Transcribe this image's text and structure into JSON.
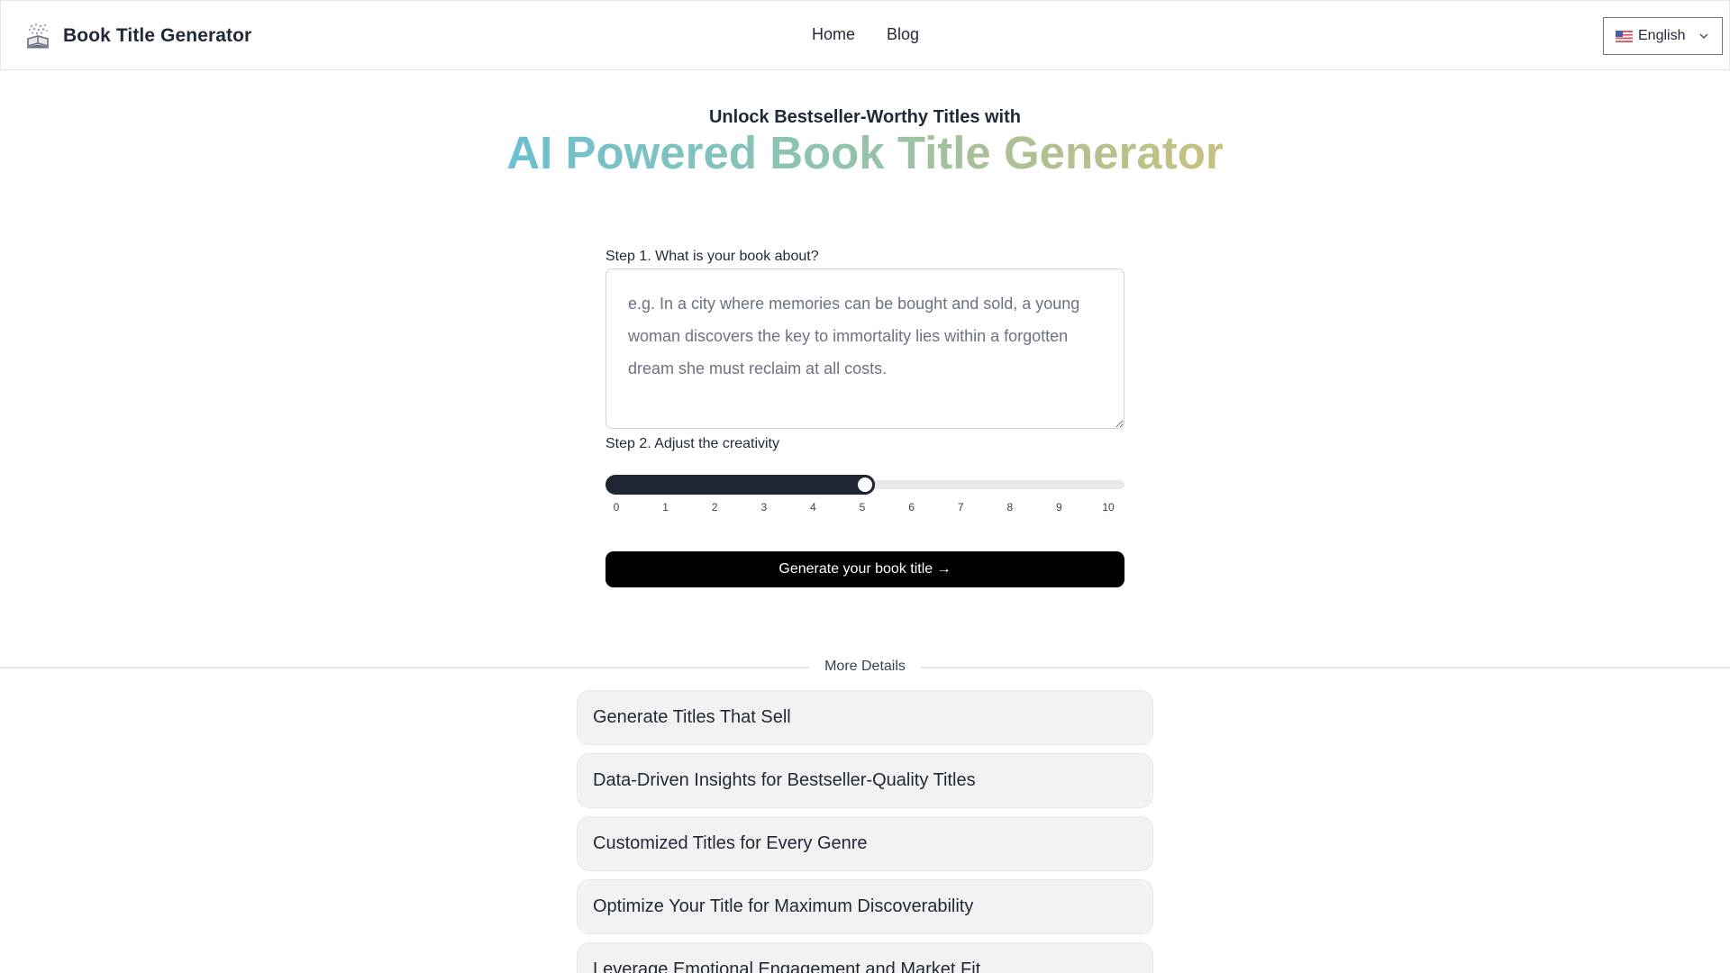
{
  "header": {
    "brand_name": "Book Title Generator",
    "logo_icon": "open-book-icon",
    "nav": [
      {
        "label": "Home"
      },
      {
        "label": "Blog"
      }
    ],
    "language": {
      "flag_icon": "us-flag-icon",
      "selected": "English"
    }
  },
  "hero": {
    "subtitle": "Unlock Bestseller-Worthy Titles with",
    "title": "AI Powered Book Title Generator",
    "gradient_colors": [
      "#6cc0d0",
      "#8cc3b4",
      "#a7c09a",
      "#c8c180"
    ]
  },
  "form": {
    "step1_label": "Step 1. What is your book about?",
    "description_value": "",
    "description_placeholder": "e.g. In a city where memories can be bought and sold, a young woman discovers the key to immortality lies within a forgotten dream she must reclaim at all costs.",
    "step2_label": "Step 2. Adjust the creativity",
    "creativity": {
      "min": 0,
      "max": 10,
      "value": 5,
      "ticks": [
        "0",
        "1",
        "2",
        "3",
        "4",
        "5",
        "6",
        "7",
        "8",
        "9",
        "10"
      ]
    },
    "generate_label": "Generate your book title →"
  },
  "details": {
    "divider_label": "More Details",
    "items": [
      {
        "label": "Generate Titles That Sell"
      },
      {
        "label": "Data-Driven Insights for Bestseller-Quality Titles"
      },
      {
        "label": "Customized Titles for Every Genre"
      },
      {
        "label": "Optimize Your Title for Maximum Discoverability"
      },
      {
        "label": "Leverage Emotional Engagement and Market Fit"
      }
    ]
  }
}
